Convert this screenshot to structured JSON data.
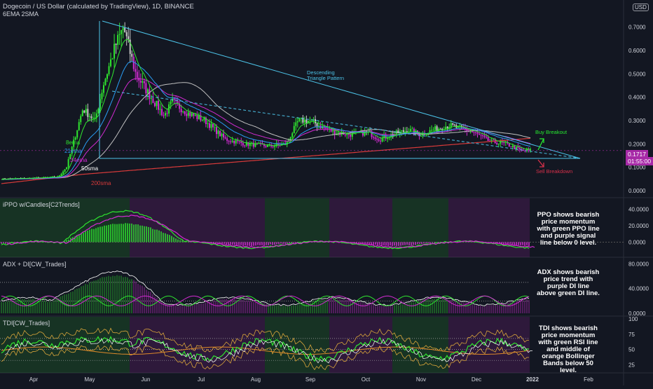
{
  "header": {
    "title": "Dogecoin / US Dollar (calculated by TradingView), 1D, BINANCE",
    "subtitle": "6EMA 2SMA",
    "currency": "USD"
  },
  "price_tag": {
    "price": "0.1717",
    "countdown": "01:55:00"
  },
  "colors": {
    "background": "#131722",
    "up": "#2fe52f",
    "down": "#d12bd1",
    "wick": "#c0c0c0",
    "ema8": "#2fe52f",
    "ema21": "#2a9df4",
    "ema34": "#d12bd1",
    "sma50": "#c0c0c0",
    "sma200": "#d83a3a",
    "trendline": "#4cc3e8",
    "buy": "#27e82f",
    "sell": "#d8304a"
  },
  "annotations": {
    "triangle": "Descending\nTriangle Pattern",
    "buy": "Buy Breakout",
    "sell": "Sell Breakdown",
    "ema8": "8ema",
    "ema21": "21ema",
    "ema34": "34ema",
    "sma50": "50sma",
    "sma200": "200sma"
  },
  "panes": {
    "ppo": {
      "title": "iPPO w/Candles[C2Trends]",
      "note": "PPO shows bearish price momentum with green PPO line and purple signal line below 0 level."
    },
    "adx": {
      "title": "ADX + DI[CW_Trades]",
      "note": "ADX shows bearish price trend with purple DI line above green DI line."
    },
    "tdi": {
      "title": "TDI[CW_Trades]",
      "note": "TDI shows bearish price momentum with green RSI line and middle of orange Bollinger Bands below 50 level."
    }
  },
  "chart_data": [
    {
      "type": "candlestick",
      "title": "Dogecoin / US Dollar (calculated by TradingView), 1D, BINANCE",
      "x_ticks": [
        "Apr",
        "May",
        "Jun",
        "Jul",
        "Aug",
        "Sep",
        "Oct",
        "Nov",
        "Dec",
        "2022",
        "Feb"
      ],
      "y_ticks": [
        "0.0000",
        "0.1000",
        "0.2000",
        "0.3000",
        "0.4000",
        "0.5000",
        "0.6000",
        "0.7000"
      ],
      "ylim": [
        0,
        0.78
      ],
      "last_price": 0.1717,
      "close_path": [
        {
          "t": 0,
          "v": 0.05
        },
        {
          "t": 0.1,
          "v": 0.055
        },
        {
          "t": 0.14,
          "v": 0.06
        },
        {
          "t": 0.16,
          "v": 0.1
        },
        {
          "t": 0.2,
          "v": 0.35
        },
        {
          "t": 0.23,
          "v": 0.3
        },
        {
          "t": 0.25,
          "v": 0.45
        },
        {
          "t": 0.28,
          "v": 0.62
        },
        {
          "t": 0.3,
          "v": 0.7
        },
        {
          "t": 0.33,
          "v": 0.5
        },
        {
          "t": 0.36,
          "v": 0.42
        },
        {
          "t": 0.4,
          "v": 0.32
        },
        {
          "t": 0.42,
          "v": 0.38
        },
        {
          "t": 0.46,
          "v": 0.33
        },
        {
          "t": 0.5,
          "v": 0.3
        },
        {
          "t": 0.55,
          "v": 0.22
        },
        {
          "t": 0.6,
          "v": 0.2
        },
        {
          "t": 0.66,
          "v": 0.19
        },
        {
          "t": 0.7,
          "v": 0.2
        },
        {
          "t": 0.73,
          "v": 0.3
        },
        {
          "t": 0.76,
          "v": 0.3
        },
        {
          "t": 0.79,
          "v": 0.27
        },
        {
          "t": 0.82,
          "v": 0.25
        },
        {
          "t": 0.86,
          "v": 0.24
        },
        {
          "t": 0.9,
          "v": 0.25
        },
        {
          "t": 0.93,
          "v": 0.22
        },
        {
          "t": 0.96,
          "v": 0.24
        },
        {
          "t": 1.0,
          "v": 0.26
        },
        {
          "t": 1.03,
          "v": 0.24
        },
        {
          "t": 1.06,
          "v": 0.26
        },
        {
          "t": 1.1,
          "v": 0.28
        },
        {
          "t": 1.12,
          "v": 0.27
        },
        {
          "t": 1.16,
          "v": 0.25
        },
        {
          "t": 1.2,
          "v": 0.21
        },
        {
          "t": 1.24,
          "v": 0.2
        },
        {
          "t": 1.28,
          "v": 0.17
        },
        {
          "t": 1.3,
          "v": 0.1717
        }
      ],
      "series": [
        {
          "name": "8ema"
        },
        {
          "name": "21ema"
        },
        {
          "name": "34ema"
        },
        {
          "name": "50sma"
        },
        {
          "name": "200sma"
        }
      ]
    },
    {
      "type": "line",
      "title": "iPPO w/Candles[C2Trends]",
      "y_ticks": [
        "40.0000",
        "20.0000",
        "0.0000"
      ],
      "ylim": [
        -15,
        50
      ]
    },
    {
      "type": "line",
      "title": "ADX + DI[CW_Trades]",
      "y_ticks": [
        "80.0000",
        "40.0000",
        "0.0000"
      ],
      "ylim": [
        0,
        85
      ]
    },
    {
      "type": "line",
      "title": "TDI[CW_Trades]",
      "y_ticks": [
        "100",
        "75",
        "50",
        "25"
      ],
      "ylim": [
        15,
        100
      ]
    }
  ]
}
